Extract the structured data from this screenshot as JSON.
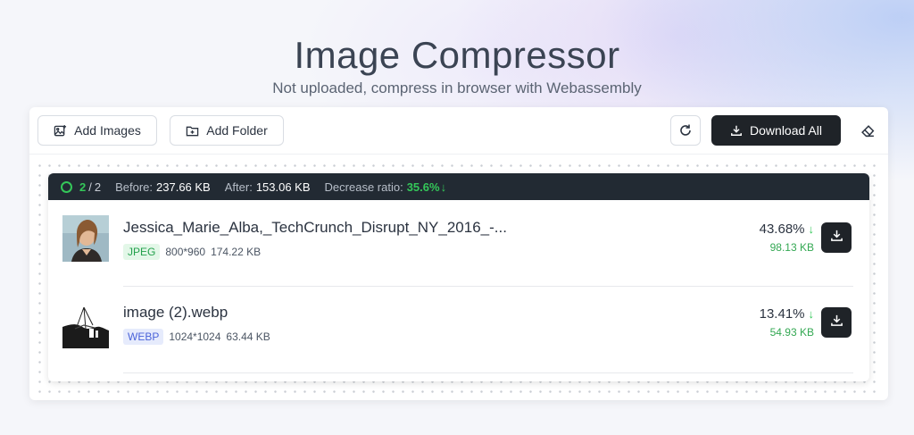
{
  "header": {
    "title": "Image Compressor",
    "subtitle": "Not uploaded, compress in browser with Webassembly"
  },
  "toolbar": {
    "add_images_label": "Add Images",
    "add_images_icon": "add-image-icon",
    "add_folder_label": "Add Folder",
    "add_folder_icon": "folder-plus-icon",
    "refresh_icon": "refresh-icon",
    "download_all_label": "Download All",
    "download_all_icon": "download-icon",
    "clear_icon": "eraser-icon"
  },
  "stats": {
    "done": "2",
    "separator": "/",
    "total": "2",
    "before_label": "Before:",
    "before_value": "237.66 KB",
    "after_label": "After:",
    "after_value": "153.06 KB",
    "ratio_label": "Decrease ratio:",
    "ratio_value": "35.6%",
    "ratio_arrow": "↓"
  },
  "files": [
    {
      "name": "Jessica_Marie_Alba,_TechCrunch_Disrupt_NY_2016_-...",
      "format": "JPEG",
      "dimensions": "800*960",
      "original_size": "174.22 KB",
      "ratio": "43.68%",
      "arrow": "↓",
      "new_size": "98.13 KB",
      "thumbnail": "portrait-thumbnail"
    },
    {
      "name": "image (2).webp",
      "format": "WEBP",
      "dimensions": "1024*1024",
      "original_size": "63.44 KB",
      "ratio": "13.41%",
      "arrow": "↓",
      "new_size": "54.93 KB",
      "thumbnail": "bw-landscape-thumbnail"
    }
  ],
  "colors": {
    "accent_green": "#34c759",
    "dark": "#1f2328",
    "jpeg_badge": "#22a04b",
    "webp_badge": "#4b63d9"
  }
}
